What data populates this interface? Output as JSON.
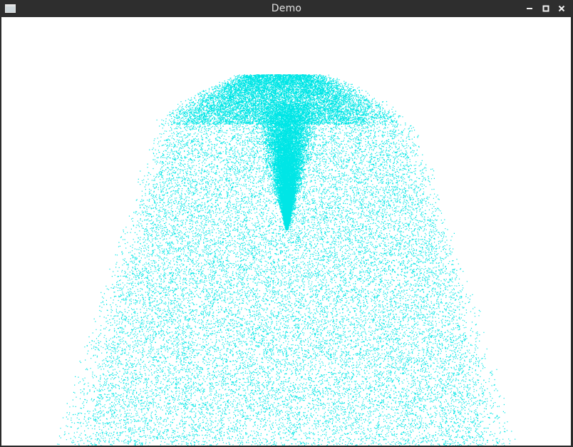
{
  "window": {
    "title": "Demo",
    "icons": {
      "app": "window-icon",
      "minimize": "minimize-icon",
      "maximize": "maximize-icon",
      "close": "close-icon"
    }
  },
  "canvas": {
    "background_color": "#ffffff",
    "particle_color": "#00e6e6",
    "frame_color": "#2b2b2b"
  }
}
